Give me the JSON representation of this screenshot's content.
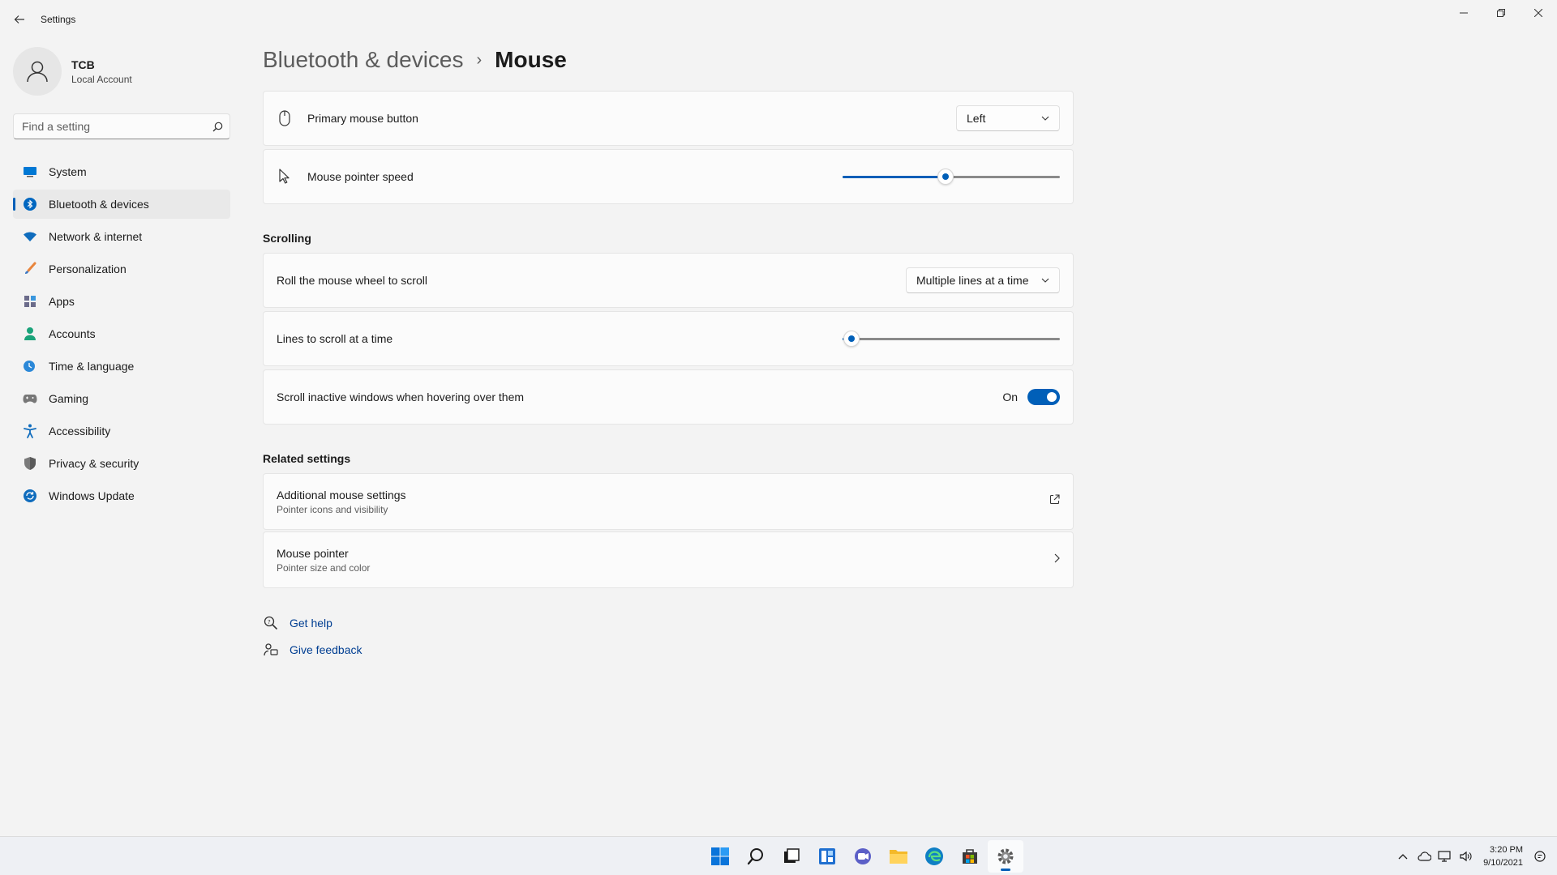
{
  "window": {
    "title": "Settings"
  },
  "profile": {
    "name": "TCB",
    "account_type": "Local Account"
  },
  "search": {
    "placeholder": "Find a setting"
  },
  "sidebar": {
    "items": [
      {
        "label": "System",
        "icon": "monitor-icon",
        "color": "#0078d4"
      },
      {
        "label": "Bluetooth & devices",
        "icon": "bluetooth-icon",
        "color": "#0067c0",
        "active": true
      },
      {
        "label": "Network & internet",
        "icon": "wifi-icon",
        "color": "#0f6cbd"
      },
      {
        "label": "Personalization",
        "icon": "brush-icon",
        "color": "#e8853d"
      },
      {
        "label": "Apps",
        "icon": "apps-icon",
        "color": "#6b6b8a"
      },
      {
        "label": "Accounts",
        "icon": "person-icon",
        "color": "#1aa37a"
      },
      {
        "label": "Time & language",
        "icon": "globe-clock-icon",
        "color": "#2b88d8"
      },
      {
        "label": "Gaming",
        "icon": "gamepad-icon",
        "color": "#777777"
      },
      {
        "label": "Accessibility",
        "icon": "accessibility-icon",
        "color": "#0f6cbd"
      },
      {
        "label": "Privacy & security",
        "icon": "shield-icon",
        "color": "#7a7a7a"
      },
      {
        "label": "Windows Update",
        "icon": "update-icon",
        "color": "#0f6cbd"
      }
    ]
  },
  "breadcrumb": {
    "parent": "Bluetooth & devices",
    "separator": "›",
    "current": "Mouse"
  },
  "settings": {
    "primary_button": {
      "label": "Primary mouse button",
      "value": "Left",
      "icon": "mouse-icon"
    },
    "pointer_speed": {
      "label": "Mouse pointer speed",
      "value_fraction": 0.475,
      "icon": "pointer-icon"
    }
  },
  "scrolling": {
    "heading": "Scrolling",
    "roll_wheel": {
      "label": "Roll the mouse wheel to scroll",
      "value": "Multiple lines at a time"
    },
    "lines_per_scroll": {
      "label": "Lines to scroll at a time",
      "value_fraction": 0.04
    },
    "inactive_scroll": {
      "label": "Scroll inactive windows when hovering over them",
      "state_label": "On",
      "enabled": true
    }
  },
  "related": {
    "heading": "Related settings",
    "items": [
      {
        "title": "Additional mouse settings",
        "subtitle": "Pointer icons and visibility",
        "icon": "external-link-icon"
      },
      {
        "title": "Mouse pointer",
        "subtitle": "Pointer size and color",
        "icon": "chevron-right-icon"
      }
    ]
  },
  "help": {
    "get_help": "Get help",
    "give_feedback": "Give feedback"
  },
  "taskbar": {
    "apps": [
      "start-icon",
      "search-icon",
      "task-view-icon",
      "widgets-icon",
      "chat-icon",
      "file-explorer-icon",
      "edge-icon",
      "store-icon",
      "settings-icon"
    ],
    "active_app": "settings-icon"
  },
  "tray": {
    "time": "3:20 PM",
    "date": "9/10/2021"
  },
  "colors": {
    "accent": "#005fb8",
    "link": "#003e92",
    "background": "#f3f3f3",
    "card": "#fbfbfb"
  }
}
